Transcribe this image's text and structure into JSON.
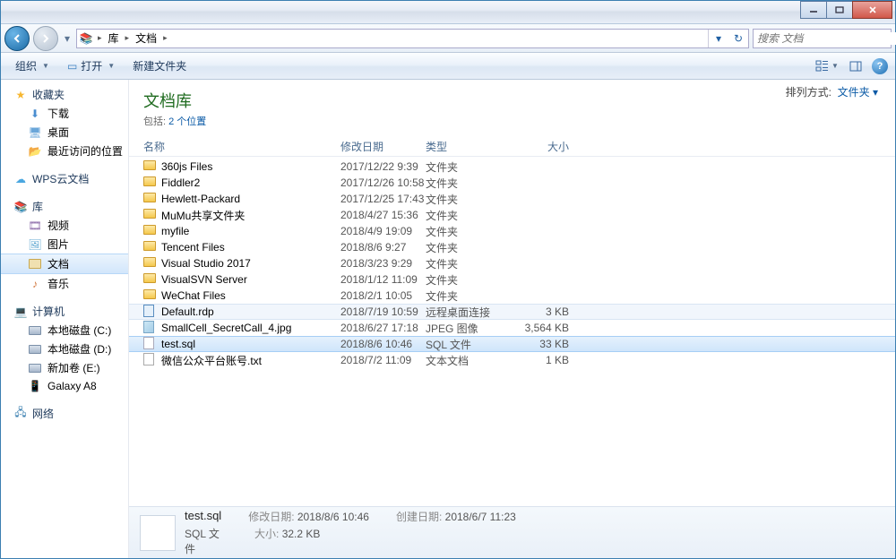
{
  "breadcrumb": {
    "seg1": "库",
    "seg2": "文档"
  },
  "search": {
    "placeholder": "搜索 文档"
  },
  "toolbar": {
    "organize": "组织",
    "open": "打开",
    "newfolder": "新建文件夹"
  },
  "sidebar": {
    "favorites": "收藏夹",
    "downloads": "下载",
    "desktop": "桌面",
    "recent": "最近访问的位置",
    "wps": "WPS云文档",
    "libraries": "库",
    "videos": "视频",
    "pictures": "图片",
    "documents": "文档",
    "music": "音乐",
    "computer": "计算机",
    "drive_c": "本地磁盘 (C:)",
    "drive_d": "本地磁盘 (D:)",
    "drive_e": "新加卷 (E:)",
    "galaxy": "Galaxy A8",
    "network": "网络"
  },
  "library": {
    "title": "文档库",
    "includes_label": "包括:",
    "includes_link": "2 个位置",
    "arrange_label": "排列方式:",
    "arrange_value": "文件夹"
  },
  "columns": {
    "name": "名称",
    "date": "修改日期",
    "type": "类型",
    "size": "大小"
  },
  "files": [
    {
      "name": "360js Files",
      "date": "2017/12/22 9:39",
      "type": "文件夹",
      "size": "",
      "icon": "folder"
    },
    {
      "name": "Fiddler2",
      "date": "2017/12/26 10:58",
      "type": "文件夹",
      "size": "",
      "icon": "folder"
    },
    {
      "name": "Hewlett-Packard",
      "date": "2017/12/25 17:43",
      "type": "文件夹",
      "size": "",
      "icon": "folder"
    },
    {
      "name": "MuMu共享文件夹",
      "date": "2018/4/27 15:36",
      "type": "文件夹",
      "size": "",
      "icon": "folder"
    },
    {
      "name": "myfile",
      "date": "2018/4/9 19:09",
      "type": "文件夹",
      "size": "",
      "icon": "folder"
    },
    {
      "name": "Tencent Files",
      "date": "2018/8/6 9:27",
      "type": "文件夹",
      "size": "",
      "icon": "folder"
    },
    {
      "name": "Visual Studio 2017",
      "date": "2018/3/23 9:29",
      "type": "文件夹",
      "size": "",
      "icon": "folder"
    },
    {
      "name": "VisualSVN Server",
      "date": "2018/1/12 11:09",
      "type": "文件夹",
      "size": "",
      "icon": "folder"
    },
    {
      "name": "WeChat Files",
      "date": "2018/2/1 10:05",
      "type": "文件夹",
      "size": "",
      "icon": "folder"
    },
    {
      "name": "Default.rdp",
      "date": "2018/7/19 10:59",
      "type": "远程桌面连接",
      "size": "3 KB",
      "icon": "rdp",
      "row": "highlight"
    },
    {
      "name": "SmallCell_SecretCall_4.jpg",
      "date": "2018/6/27 17:18",
      "type": "JPEG 图像",
      "size": "3,564 KB",
      "icon": "img"
    },
    {
      "name": "test.sql",
      "date": "2018/8/6 10:46",
      "type": "SQL 文件",
      "size": "33 KB",
      "icon": "sql",
      "row": "selected"
    },
    {
      "name": "微信公众平台账号.txt",
      "date": "2018/7/2 11:09",
      "type": "文本文档",
      "size": "1 KB",
      "icon": "txt"
    }
  ],
  "details": {
    "name": "test.sql",
    "type": "SQL 文件",
    "mod_label": "修改日期:",
    "mod_value": "2018/8/6 10:46",
    "create_label": "创建日期:",
    "create_value": "2018/6/7 11:23",
    "size_label": "大小:",
    "size_value": "32.2 KB"
  }
}
